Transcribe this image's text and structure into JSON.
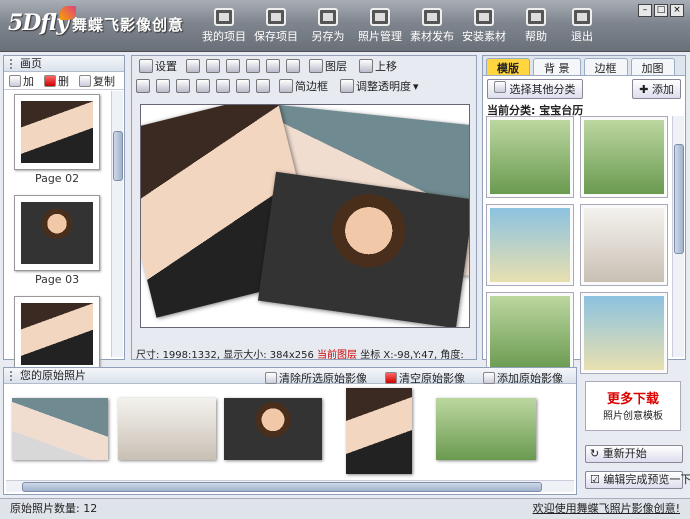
{
  "window": {
    "minimize": "–",
    "maximize": "□",
    "close": "×"
  },
  "logo": {
    "brand": "5Dfly",
    "app_name": "舞蝶飞影像创意"
  },
  "toolbar": [
    {
      "label": "我的项目",
      "icon": "folder-icon"
    },
    {
      "label": "保存项目",
      "icon": "save-icon"
    },
    {
      "label": "另存为",
      "icon": "save-as-icon"
    },
    {
      "label": "照片管理",
      "icon": "photo-manage-icon"
    },
    {
      "label": "素材发布",
      "icon": "publish-icon"
    },
    {
      "label": "安装素材",
      "icon": "install-icon"
    },
    {
      "label": "帮助",
      "icon": "help-icon"
    },
    {
      "label": "退出",
      "icon": "exit-icon"
    }
  ],
  "left": {
    "title": "画页",
    "add": "加",
    "delete": "删",
    "copy": "复制",
    "pages": [
      "Page 02",
      "Page 03"
    ]
  },
  "center": {
    "settings": "设置",
    "layer": "图层",
    "move_up": "上移",
    "simple_frame": "简边框",
    "transparency": "调整透明度",
    "status": {
      "size_label": "尺寸:",
      "size": "1998:1332,",
      "display_label": "显示大小:",
      "display": "384x256",
      "current_layer": "当前图层",
      "coord_label": "坐标",
      "coord": "X:-98,Y:47,",
      "angle_label": "角度:"
    }
  },
  "right": {
    "tabs": [
      "模版",
      "背 景",
      "边框",
      "加图"
    ],
    "select_category": "选择其他分类",
    "add": "添加",
    "current_category_label": "当前分类:",
    "current_category": "宝宝台历"
  },
  "bottom": {
    "title": "您的原始照片",
    "clear_selected": "清除所选原始影像",
    "clear_all": "清空原始影像",
    "add_original": "添加原始影像"
  },
  "side": {
    "more_title": "更多下载",
    "more_sub": "照片创意模板",
    "restart": "重新开始",
    "preview": "编辑完成预览一下"
  },
  "footer": {
    "count_label": "原始照片数量:",
    "count": "12",
    "welcome": "欢迎使用舞蝶飞照片影像创意!"
  }
}
